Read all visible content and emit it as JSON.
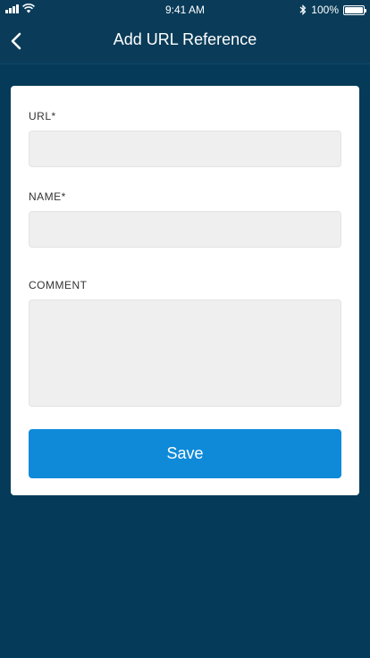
{
  "status_bar": {
    "time": "9:41 AM",
    "battery": "100%",
    "icons": [
      "signal-icon",
      "wifi-icon",
      "bluetooth-icon",
      "battery-icon"
    ]
  },
  "nav": {
    "title": "Add URL Reference",
    "back_icon": "chevron-left-icon"
  },
  "form": {
    "url_label": "URL*",
    "url_value": "",
    "name_label": "NAME*",
    "name_value": "",
    "comment_label": "COMMENT",
    "comment_value": "",
    "save_label": "Save"
  },
  "colors": {
    "background": "#053a58",
    "header": "#0a3c59",
    "card": "#ffffff",
    "input_bg": "#efefef",
    "accent": "#0e8ad9"
  }
}
